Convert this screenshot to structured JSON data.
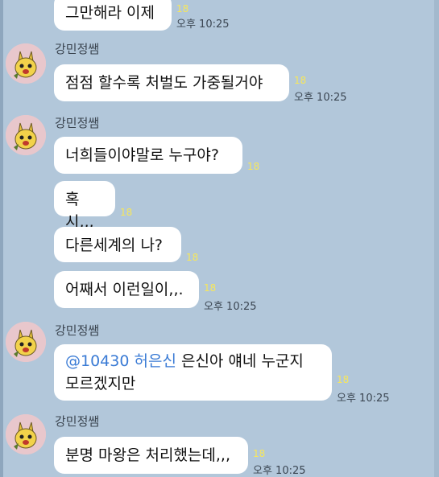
{
  "sender_name": "강민정쌤",
  "messages": [
    {
      "text": "그만해라 이제",
      "read": "18",
      "time": "오후 10:25"
    },
    {
      "text": "점점 할수록 처벌도 가중될거야",
      "read": "18",
      "time": "오후 10:25"
    },
    {
      "text": "너희들이야말로 누구야?",
      "read": "18"
    },
    {
      "text": "혹시,,,",
      "read": "18"
    },
    {
      "text": "다른세계의 나?",
      "read": "18"
    },
    {
      "text": "어째서 이런일이,,.",
      "read": "18",
      "time": "오후 10:25"
    },
    {
      "mention": "@10430 허은신",
      "line1_rest": " 은신아 얘네 누군지",
      "line2": "모르겠지만",
      "read": "18",
      "time": "오후 10:25"
    },
    {
      "text": "분명 마왕은 처리했는데,,,",
      "read": "18",
      "time": "오후 10:25"
    }
  ]
}
